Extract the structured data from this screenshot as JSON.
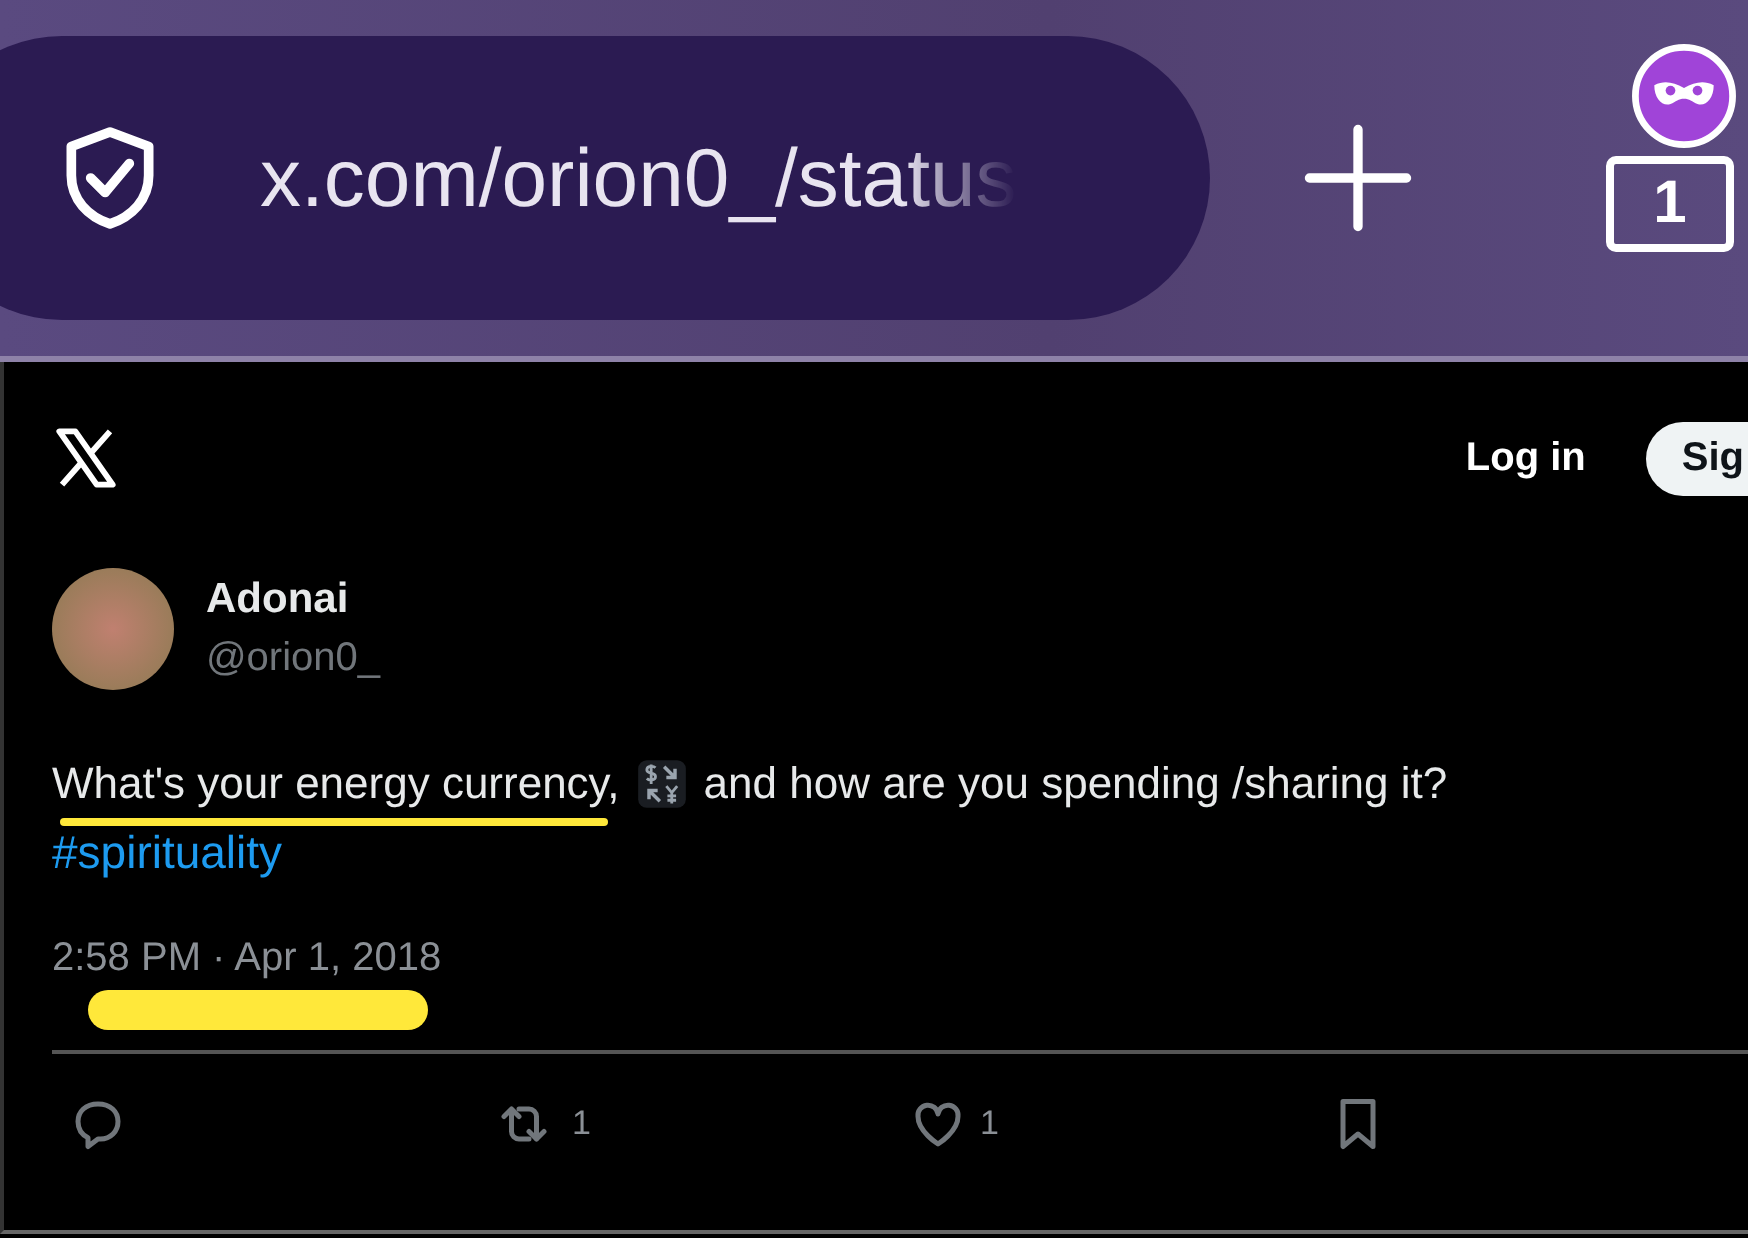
{
  "browser": {
    "url": "x.com/orion0_/status",
    "tab_count": "1"
  },
  "header": {
    "login": "Log in",
    "signup": "Sig"
  },
  "tweet": {
    "author": "Adonai",
    "handle": "@orion0_",
    "text_before": "What's your energy currency,",
    "text_after": "and how are you spending /sharing it?",
    "hashtag": "#spirituality",
    "timestamp": "2:58 PM · Apr 1, 2018"
  },
  "actions": [
    {
      "kind": "reply"
    },
    {
      "kind": "repost",
      "count": "1"
    },
    {
      "kind": "like",
      "count": "1"
    },
    {
      "kind": "bookmark"
    }
  ]
}
